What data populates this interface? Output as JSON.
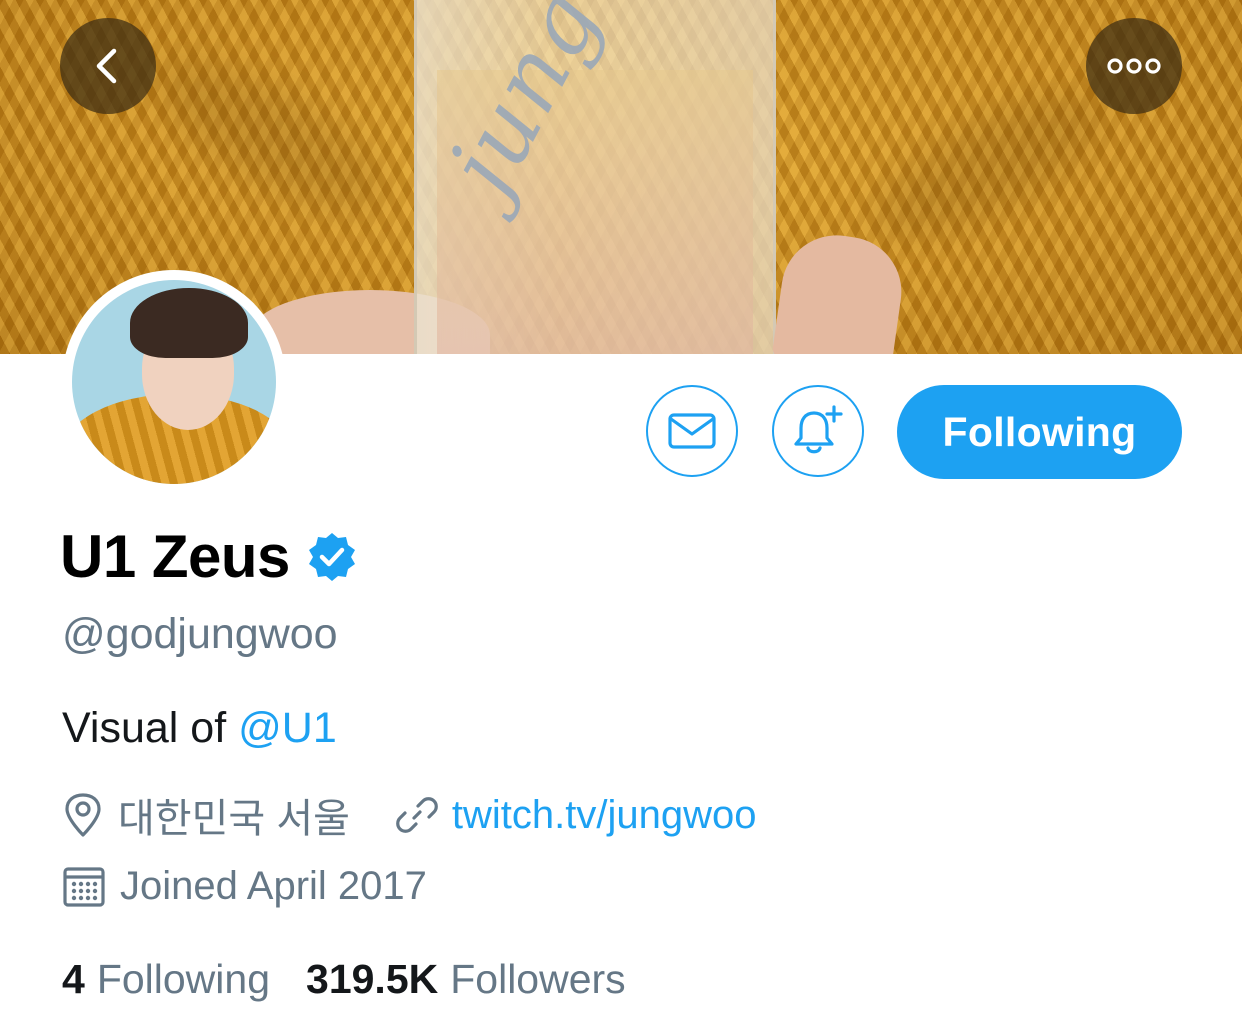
{
  "header": {
    "banner_script_text": "jungwoo",
    "back_icon": "chevron-left-icon",
    "more_icon": "more-horizontal-icon"
  },
  "actions": {
    "message_icon": "envelope-icon",
    "notify_icon": "bell-plus-icon",
    "follow_label": "Following"
  },
  "profile": {
    "display_name": "U1 Zeus",
    "verified": true,
    "handle": "@godjungwoo",
    "bio_prefix": "Visual of ",
    "bio_mention": "@U1",
    "location": "대한민국 서울",
    "website": "twitch.tv/jungwoo",
    "joined": "Joined April 2017"
  },
  "stats": {
    "following_count": "4",
    "following_label": "Following",
    "followers_count": "319.5K",
    "followers_label": "Followers"
  },
  "colors": {
    "accent": "#1da1f2",
    "secondary_text": "#657786",
    "primary_text": "#14171a"
  }
}
